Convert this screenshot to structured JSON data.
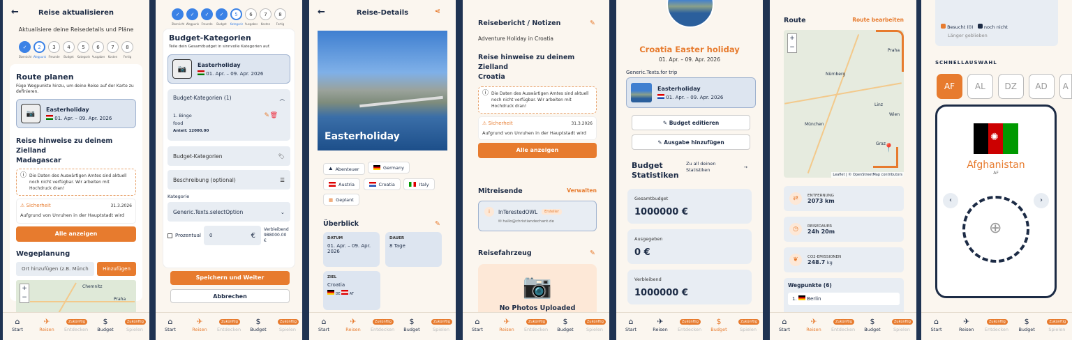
{
  "nav": {
    "start": "Start",
    "reisen": "Reisen",
    "entdecken": "Entdecken",
    "budget": "Budget",
    "spielen": "Spielen",
    "soon": "Zukünftig"
  },
  "p1": {
    "title": "Reise aktualisieren",
    "subtitle": "Aktualisiere deine Reisedetails und Pläne",
    "steps": [
      "1",
      "2",
      "3",
      "4",
      "5",
      "6",
      "7",
      "8"
    ],
    "step_labels": [
      "Übersicht",
      "Wegpunkte",
      "Freunde",
      "Budget",
      "Kategorien",
      "Ausgaben",
      "Kosten",
      "Fertig"
    ],
    "section_title": "Route planen",
    "section_desc": "Füge Wegpunkte hinzu, um deine Reise auf der Karte zu definieren.",
    "trip_name": "Easterholiday",
    "trip_dates": "01. Apr. – 09. Apr. 2026",
    "hints_title": "Reise hinweise zu deinem Zielland",
    "hints_country": "Madagascar",
    "warn_text": "Die Daten des Auswärtigen Amtes sind aktuell noch nicht verfügbar. Wir arbeiten mit Hochdruck dran!",
    "safety_label": "Sicherheit",
    "safety_date": "31.3.2026",
    "safety_text": "Aufgrund von Unruhen in der Hauptstadt wird",
    "show_all": "Alle anzeigen",
    "route_title": "Wegeplanung",
    "place_placeholder": "Ort hinzufügen (z.B. Münch",
    "add_btn": "Hinzufügen",
    "map_labels": [
      "Chemnitz",
      "Praha"
    ]
  },
  "p2": {
    "steps": [
      "✓",
      "✓",
      "✓",
      "✓",
      "5",
      "6",
      "7",
      "8"
    ],
    "step_labels": [
      "Übersicht",
      "Wegpunkte",
      "Freunde",
      "Budget",
      "Kategorien",
      "Ausgaben",
      "Kosten",
      "Fertig"
    ],
    "title": "Budget-Kategorien",
    "desc": "Teile dein Gesamtbudget in sinnvolle Kategorien auf.",
    "trip_name": "Easterholiday",
    "trip_dates": "01. Apr. – 09. Apr. 2026",
    "acc_title": "Budget-Kategorien (1)",
    "item_name": "1. Bingo",
    "item_cat": "food",
    "item_share": "Anteil: 12000.00",
    "field_cat": "Budget-Kategorien",
    "field_desc": "Beschreibung (optional)",
    "kategorie": "Kategorie",
    "select_val": "Generic.Texts.selectOption",
    "prozentual": "Prozentual",
    "amount": "0",
    "currency": "€",
    "remaining_label": "Verbleibend",
    "remaining_val": "988000.00",
    "remaining_cur": "€",
    "save_btn": "Speichern und Weiter",
    "cancel_btn": "Abbrechen"
  },
  "p3": {
    "title": "Reise-Details",
    "trip_name": "Easterholiday",
    "chips": [
      {
        "label": "Abenteuer",
        "icon": "mountain"
      },
      {
        "label": "Germany",
        "icon": "flag-de"
      },
      {
        "label": "Austria",
        "icon": "flag-at"
      },
      {
        "label": "Croatia",
        "icon": "flag-hr"
      },
      {
        "label": "Italy",
        "icon": "flag-it"
      },
      {
        "label": "Geplant",
        "icon": "calendar"
      }
    ],
    "overview": "Überblick",
    "datum_k": "DATUM",
    "datum_v": "01. Apr. – 09. Apr. 2026",
    "dauer_k": "DAUER",
    "dauer_v": "8 Tage",
    "ziel_k": "ZIEL",
    "ziel_v": "Croatia",
    "ziel_flags": [
      "DE",
      "AT",
      "..."
    ]
  },
  "p4": {
    "report_title": "Reisebericht / Notizen",
    "report_text": "Adventure Holiday in Croatia",
    "hints_title": "Reise hinweise zu deinem Zielland",
    "hints_country": "Croatia",
    "warn_text": "Die Daten des Auswärtigen Amtes sind aktuell noch nicht verfügbar. Wir arbeiten mit Hochdruck dran!",
    "safety_label": "Sicherheit",
    "safety_date": "31.3.2026",
    "safety_text": "Aufgrund von Unruhen in der Hauptstadt wird",
    "show_all": "Alle anzeigen",
    "companions": "Mitreisende",
    "manage": "Verwalten",
    "companion_name": "InTerestedOWL",
    "companion_badge": "Ersteller",
    "companion_email": "hallo@christiandechant.de",
    "vehicle": "Reisefahrzeug",
    "no_photos": "No Photos Uploaded"
  },
  "p5": {
    "trip_title": "Croatia Easter holiday",
    "trip_dates": "01. Apr. – 09. Apr. 2026",
    "generic_label": "Generic.Texts.for trip",
    "card_name": "Easterholiday",
    "card_dates": "01. Apr. – 09. Apr. 2026",
    "edit_budget": "Budget editieren",
    "add_expense": "Ausgabe hinzufügen",
    "stats_title_1": "Budget",
    "stats_title_2": "Statistiken",
    "all_stats": "Zu all deinen Statistiken",
    "total_k": "Gesamtbudget",
    "total_v": "1000000 €",
    "spent_k": "Ausgegeben",
    "spent_v": "0 €",
    "remain_k": "Verbleibend",
    "remain_v": "1000000 €"
  },
  "p6": {
    "route": "Route",
    "edit_route": "Route bearbeiten",
    "map_labels": [
      "Praha",
      "Nürnberg",
      "Linz",
      "Wien",
      "München",
      "Graz"
    ],
    "attribution": "Leaflet | © OpenStreetMap contributors",
    "dist_k": "ENTFERNUNG",
    "dist_v": "2073 km",
    "dur_k": "REISEDAUER",
    "dur_v": "24h 20m",
    "co2_k": "CO2-EMISSIONEN",
    "co2_v": "248.7",
    "co2_u": "kg",
    "wp_title": "Wegpunkte (6)",
    "wp_first": "1.",
    "wp_first_name": "Berlin"
  },
  "p7": {
    "legend_visited": "Besucht (0)",
    "legend_not": "noch nicht",
    "legend_longer": "Länger geblieben",
    "quick": "SCHNELLAUSWAHL",
    "langs": [
      "AF",
      "AL",
      "DZ",
      "AD",
      "A"
    ],
    "country": "Afghanistan",
    "code": "AF",
    "colors": {
      "accent": "#e77b2e",
      "navy": "#1c2b45"
    }
  }
}
